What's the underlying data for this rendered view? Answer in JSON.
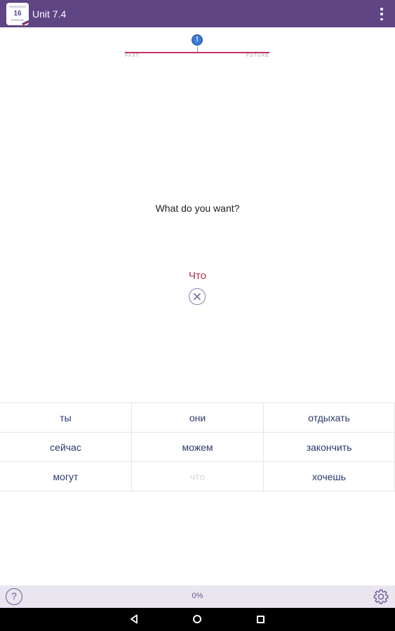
{
  "appbar": {
    "icon_top_text": "PROGRESS",
    "icon_number": "16",
    "icon_bottom_text": "RUSSIAN",
    "title": "Unit 7.4",
    "icons": {
      "menu": "overflow-menu-icon"
    }
  },
  "timeline": {
    "past_label": "PAST",
    "future_label": "FUTURE",
    "marker_label": "!",
    "line_color": "#c3365e",
    "marker_color": "#3a7bd5"
  },
  "prompt": "What do you want?",
  "answer": "Что",
  "words": [
    {
      "text": "ты",
      "used": false
    },
    {
      "text": "они",
      "used": false
    },
    {
      "text": "отдыхать",
      "used": false
    },
    {
      "text": "сейчас",
      "used": false
    },
    {
      "text": "можем",
      "used": false
    },
    {
      "text": "закончить",
      "used": false
    },
    {
      "text": "могут",
      "used": false
    },
    {
      "text": "что",
      "used": true
    },
    {
      "text": "хочешь",
      "used": false
    }
  ],
  "bottom": {
    "help_label": "?",
    "progress_text": "0%",
    "progress": 0
  },
  "colors": {
    "brand": "#5f4584",
    "answer": "#b0304f",
    "word": "#2b3a6b"
  }
}
